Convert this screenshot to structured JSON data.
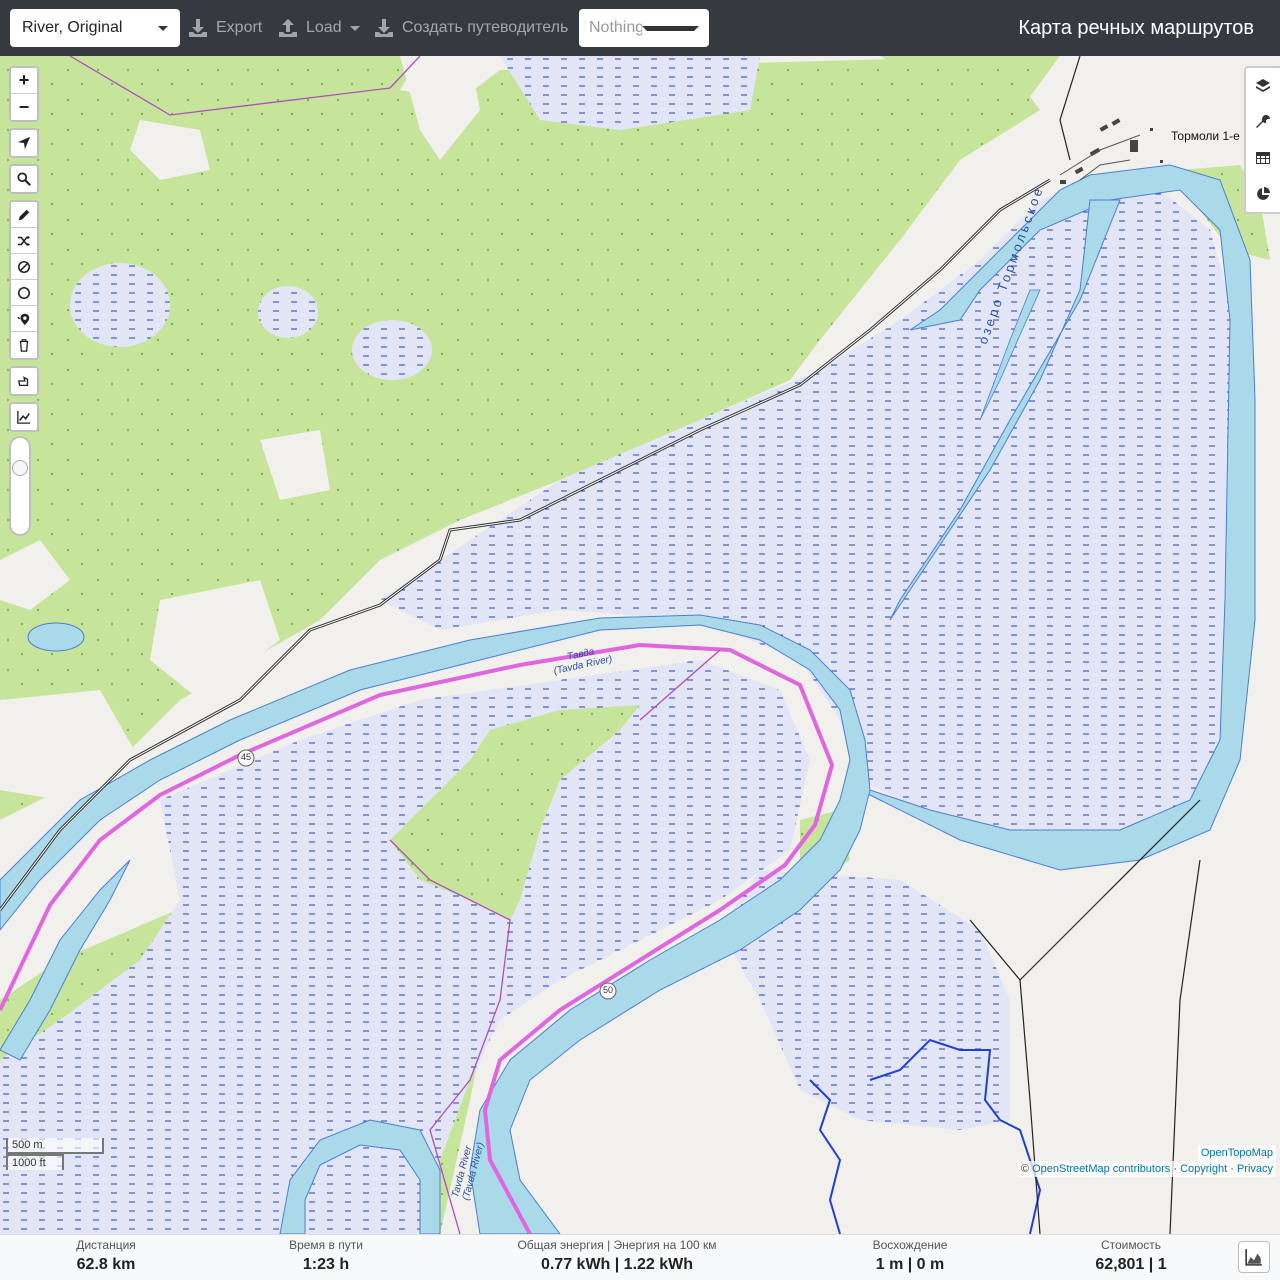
{
  "header": {
    "profile_value": "River, Original",
    "export_label": "Export",
    "load_label": "Load",
    "guide_label": "Создать путеводитель",
    "select_placeholder": "Nothing selected",
    "brand": "Карта речных маршрутов"
  },
  "map": {
    "zoom_in": "+",
    "zoom_out": "−",
    "labels": {
      "village": "Тормоли 1-е",
      "lake": "озеро Тормольское",
      "river_top_1": "Тавда",
      "river_top_2": "(Tavda River)",
      "river_bottom_1": "Tavda River",
      "river_bottom_2": "(Tavda River)",
      "marker_45": "45",
      "marker_50": "50"
    },
    "scale": {
      "metric": "500 m",
      "imperial": "1000 ft"
    },
    "attribution": {
      "tiles": "OpenTopoMap",
      "copyright_prefix": "©",
      "osm": "OpenStreetMap contributors",
      "copyright": "Copyright",
      "privacy": "Privacy",
      "sep": "·"
    }
  },
  "stats": {
    "distance_label": "Дистанция",
    "distance_value": "62.8 km",
    "time_label": "Время в пути",
    "time_value": "1:23 h",
    "energy_label": "Общая энергия | Энергия на 100 км",
    "energy_value": "0.77 kWh | 1.22 kWh",
    "ascent_label": "Восхождение",
    "ascent_value": "1 m | 0 m",
    "cost_label": "Стоимость",
    "cost_value": "62,801 | 1"
  },
  "icons": {
    "export": "download-icon",
    "load": "upload-icon",
    "guide": "download-icon",
    "layers": "layers-icon",
    "tools": "wrench-icon",
    "table": "table-icon",
    "pie": "pie-chart-icon"
  },
  "colors": {
    "forest": "#c8e6a0",
    "water": "#aadaea",
    "marsh": "#dfe3f6",
    "route": "#e066e0",
    "navbar": "#343a40"
  }
}
